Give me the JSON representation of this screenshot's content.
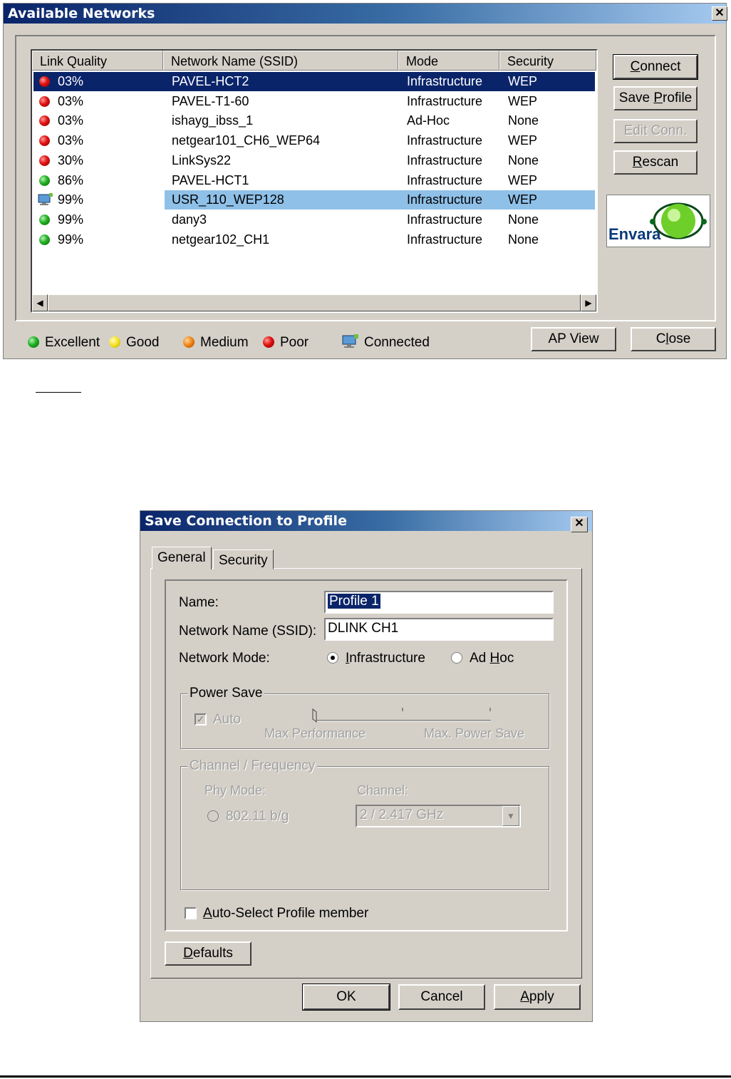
{
  "available_networks": {
    "title": "Available Networks",
    "close_glyph": "✕",
    "columns": [
      "Link Quality",
      "Network Name (SSID)",
      "Mode",
      "Security"
    ],
    "rows": [
      {
        "quality": "03%",
        "ssid": "PAVEL-HCT2",
        "mode": "Infrastructure",
        "security": "WEP",
        "status": "poor",
        "state": "selected"
      },
      {
        "quality": "03%",
        "ssid": "PAVEL-T1-60",
        "mode": "Infrastructure",
        "security": "WEP",
        "status": "poor",
        "state": ""
      },
      {
        "quality": "03%",
        "ssid": "ishayg_ibss_1",
        "mode": "Ad-Hoc",
        "security": "None",
        "status": "poor",
        "state": ""
      },
      {
        "quality": "03%",
        "ssid": "netgear101_CH6_WEP64",
        "mode": "Infrastructure",
        "security": "WEP",
        "status": "poor",
        "state": ""
      },
      {
        "quality": "30%",
        "ssid": "LinkSys22",
        "mode": "Infrastructure",
        "security": "None",
        "status": "poor",
        "state": ""
      },
      {
        "quality": "86%",
        "ssid": "PAVEL-HCT1",
        "mode": "Infrastructure",
        "security": "WEP",
        "status": "excellent",
        "state": ""
      },
      {
        "quality": "99%",
        "ssid": "USR_110_WEP128",
        "mode": "Infrastructure",
        "security": "WEP",
        "status": "connected",
        "state": "connected"
      },
      {
        "quality": "99%",
        "ssid": "dany3",
        "mode": "Infrastructure",
        "security": "None",
        "status": "excellent",
        "state": ""
      },
      {
        "quality": "99%",
        "ssid": "netgear102_CH1",
        "mode": "Infrastructure",
        "security": "None",
        "status": "excellent",
        "state": ""
      }
    ],
    "buttons": {
      "connect": {
        "pre": "",
        "key": "C",
        "post": "onnect"
      },
      "save_profile": {
        "pre": "Save ",
        "key": "P",
        "post": "rofile"
      },
      "edit_conn": "Edit Conn.",
      "rescan": {
        "pre": "",
        "key": "R",
        "post": "escan"
      },
      "ap_view": "AP View",
      "close": {
        "pre": "C",
        "key": "l",
        "post": "ose"
      }
    },
    "logo_text": "Envara",
    "legend": [
      "Excellent",
      "Good",
      "Medium",
      "Poor",
      "Connected"
    ],
    "status_colors": {
      "excellent": "#20b020",
      "good": "#f5e020",
      "medium": "#f08010",
      "poor": "#e01010"
    }
  },
  "save_connection": {
    "title": "Save Connection to Profile",
    "close_glyph": "✕",
    "tabs": [
      "General",
      "Security"
    ],
    "name_label": "Name:",
    "name_value": "Profile 1",
    "ssid_label": "Network Name (SSID):",
    "ssid_value": "DLINK CH1",
    "mode_label": "Network Mode:",
    "mode_infra": {
      "pre": "",
      "key": "I",
      "post": "nfrastructure"
    },
    "mode_adhoc": {
      "pre": "Ad ",
      "key": "H",
      "post": "oc"
    },
    "power_save_label": "Power Save",
    "auto_label": "Auto",
    "max_perf": "Max Performance",
    "max_power": "Max. Power Save",
    "channel_group_label": "Channel / Frequency",
    "phy_mode_label": "Phy Mode:",
    "phy_mode_value": "802.11 b/g",
    "channel_label": "Channel:",
    "channel_value": "2 / 2.417 GHz",
    "auto_select": {
      "pre": "",
      "key": "A",
      "post": "uto-Select Profile member"
    },
    "defaults": {
      "pre": "",
      "key": "D",
      "post": "efaults"
    },
    "ok": "OK",
    "cancel": "Cancel",
    "apply": {
      "pre": "",
      "key": "A",
      "post": "pply"
    }
  }
}
